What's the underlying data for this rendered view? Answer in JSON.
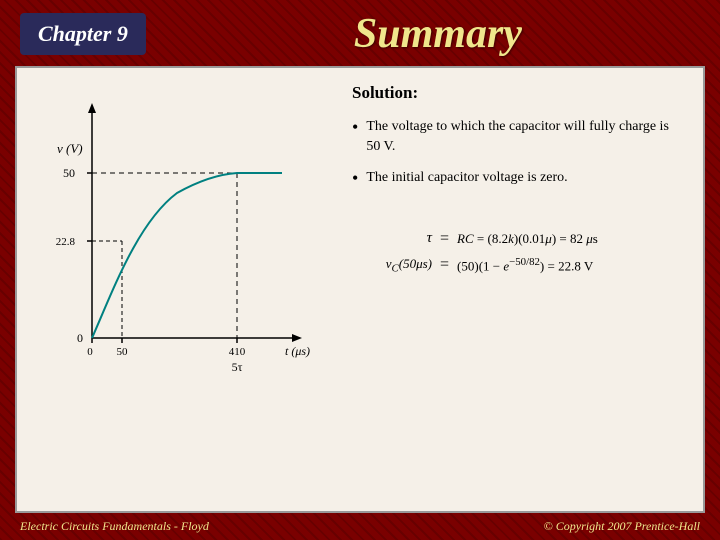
{
  "header": {
    "chapter_label": "Chapter 9",
    "summary_title": "Summary"
  },
  "solution": {
    "heading": "Solution:",
    "bullets": [
      "The voltage to which the capacitor will fully charge is 50 V.",
      "The initial capacitor voltage is zero."
    ],
    "equations": [
      {
        "left": "τ",
        "equals": "=",
        "right": "RC = (8.2k)(0.01μ) = 82 μs"
      },
      {
        "left": "v_C(50μs)",
        "equals": "=",
        "right": "(50)(1 − e^(−50/82)) = 22.8 V"
      }
    ]
  },
  "graph": {
    "y_label": "v (V)",
    "x_label": "t (μs)",
    "y_values": [
      "50",
      "22.8",
      "0"
    ],
    "x_values": [
      "0",
      "50",
      "410"
    ],
    "x_sub_label": "5τ",
    "dashed_label_50": "50",
    "dashed_label_228": "22.8"
  },
  "footer": {
    "left": "Electric Circuits Fundamentals - Floyd",
    "right": "© Copyright 2007 Prentice-Hall"
  },
  "colors": {
    "background": "#7a0000",
    "chapter_bg": "#2a2a5a",
    "title_color": "#f0e68c",
    "content_bg": "#f5f0e8"
  }
}
